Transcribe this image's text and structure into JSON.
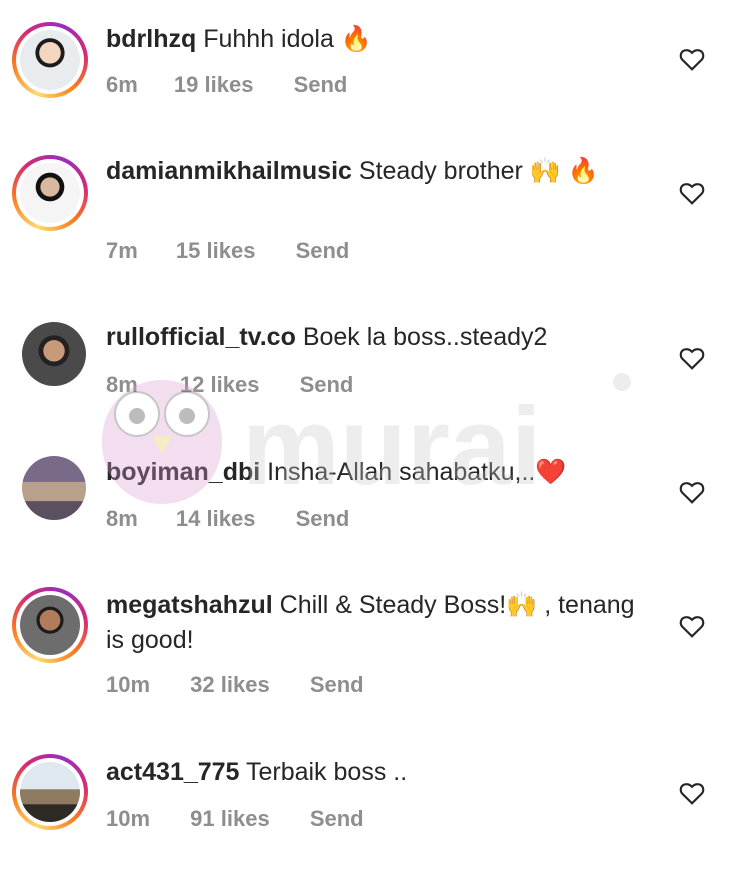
{
  "comments": [
    {
      "username": "bdrlhzq",
      "text": "Fuhhh idola 🔥",
      "time": "6m",
      "likes": "19 likes",
      "reply": "Send",
      "story_ring": true
    },
    {
      "username": "damianmikhailmusic",
      "text": "Steady brother 🙌 🔥",
      "time": "7m",
      "likes": "15 likes",
      "reply": "Send",
      "story_ring": true
    },
    {
      "username": "rullofficial_tv.co",
      "text": "Boek la boss..steady2",
      "time": "8m",
      "likes": "12 likes",
      "reply": "Send",
      "story_ring": false
    },
    {
      "username": "boyiman_dbi",
      "text": "Insha-Allah sahabatku,..❤️",
      "time": "8m",
      "likes": "14 likes",
      "reply": "Send",
      "story_ring": false
    },
    {
      "username": "megatshahzul",
      "text": "Chill & Steady Boss!🙌 , tenang is good!",
      "time": "10m",
      "likes": "32 likes",
      "reply": "Send",
      "story_ring": true
    },
    {
      "username": "act431_775",
      "text": "Terbaik boss ..",
      "time": "10m",
      "likes": "91 likes",
      "reply": "Send",
      "story_ring": true
    }
  ],
  "watermark": {
    "text": "murai"
  },
  "colors": {
    "text": "#262626",
    "meta": "#8e8e8e",
    "ring_start": "#feda75",
    "ring_end": "#d62976"
  },
  "icons": {
    "like": "heart-outline-icon"
  }
}
